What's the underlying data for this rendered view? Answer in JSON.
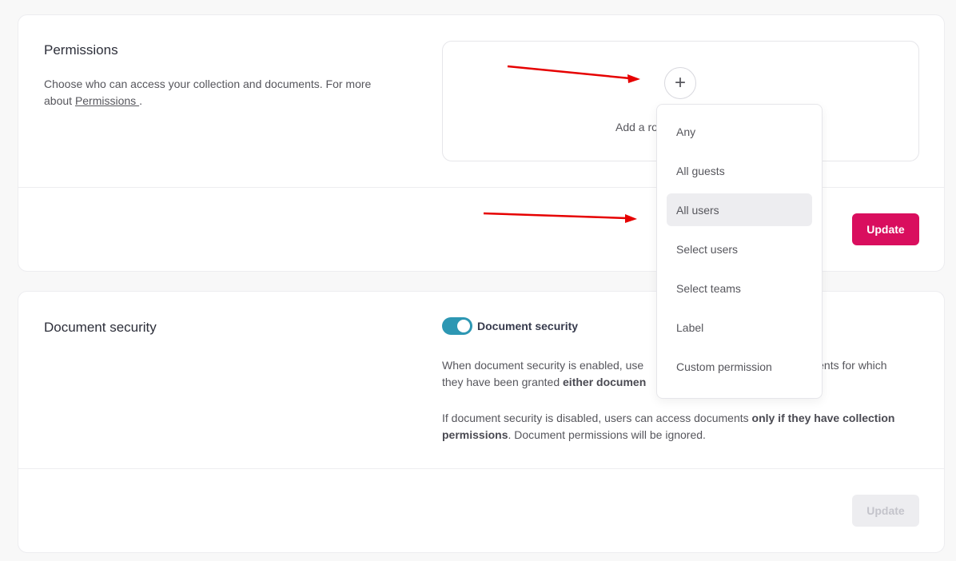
{
  "permissions": {
    "title": "Permissions",
    "desc_prefix": "Choose who can access your collection and documents. For more about ",
    "desc_link": "Permissions ",
    "desc_suffix": ".",
    "role_box_text": "Add a ro",
    "add_symbol": "+",
    "update_label": "Update"
  },
  "security": {
    "title": "Document security",
    "toggle_label": "Document security",
    "toggle_on": true,
    "para1_prefix": "When document security is enabled, use",
    "para1_middle": "ents for which",
    "para1_line2_prefix": "they have been granted ",
    "para1_bold": "either documen",
    "para2_prefix": "If document security is disabled, users can access documents ",
    "para2_bold": "only if they have collection permissions",
    "para2_suffix": ". Document permissions will be ignored.",
    "update_label": "Update"
  },
  "dropdown": {
    "items": [
      {
        "label": "Any"
      },
      {
        "label": "All guests"
      },
      {
        "label": "All users"
      },
      {
        "label": "Select users"
      },
      {
        "label": "Select teams"
      },
      {
        "label": "Label"
      },
      {
        "label": "Custom permission"
      }
    ],
    "hovered_index": 2
  },
  "colors": {
    "accent": "#d90e5e",
    "toggle": "#2d97b3",
    "annotation_arrow": "#e60000"
  }
}
